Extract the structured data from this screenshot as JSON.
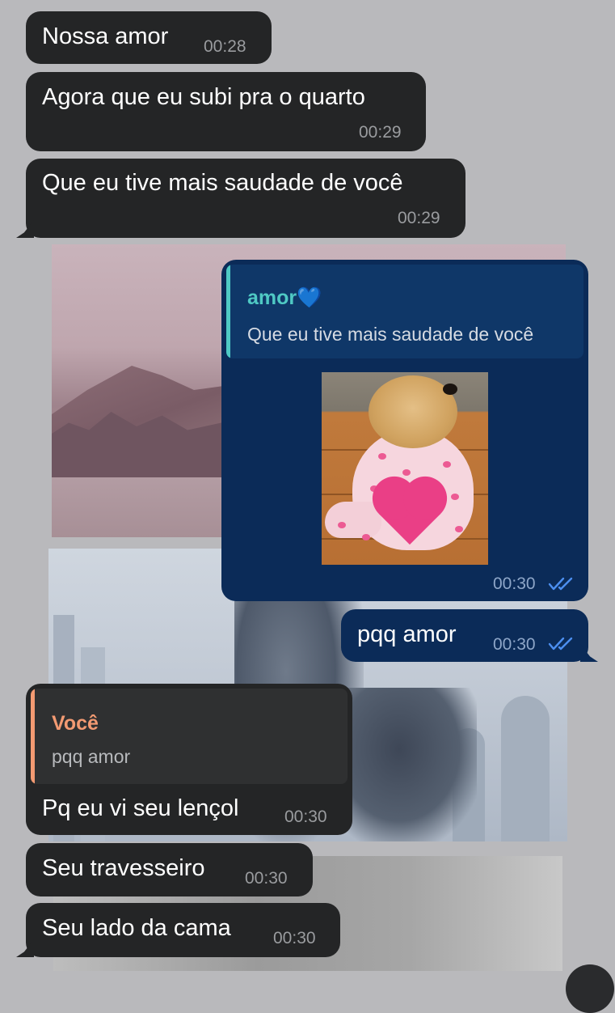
{
  "colors": {
    "incoming_bubble": "#242526",
    "outgoing_bubble": "#0b2b58",
    "timestamp_in": "#9a9c9f",
    "timestamp_out": "#8ea6c8",
    "read_ticks": "#4c8ff0",
    "reply_name_outgoing": "#4fc9c4",
    "reply_name_incoming": "#f39a72"
  },
  "messages": [
    {
      "text": "Nossa amor",
      "time": "00:28"
    },
    {
      "text": "Agora que eu subi pra o quarto",
      "time": "00:29"
    },
    {
      "text": "Que eu tive mais saudade de você",
      "time": "00:29"
    },
    {
      "reply_name": "amor💙",
      "reply_text": "Que eu tive mais saudade de você",
      "image": "puppy-in-pink-heart-pajamas",
      "time": "00:30",
      "status_icon": "double-check-icon"
    },
    {
      "text": "pqq amor",
      "time": "00:30",
      "status_icon": "double-check-icon"
    },
    {
      "reply_name": "Você",
      "reply_text": "pqq amor",
      "text": "Pq eu vi seu lençol",
      "time": "00:30"
    },
    {
      "text": "Seu travesseiro",
      "time": "00:30"
    },
    {
      "text": "Seu lado da cama",
      "time": "00:30"
    }
  ]
}
